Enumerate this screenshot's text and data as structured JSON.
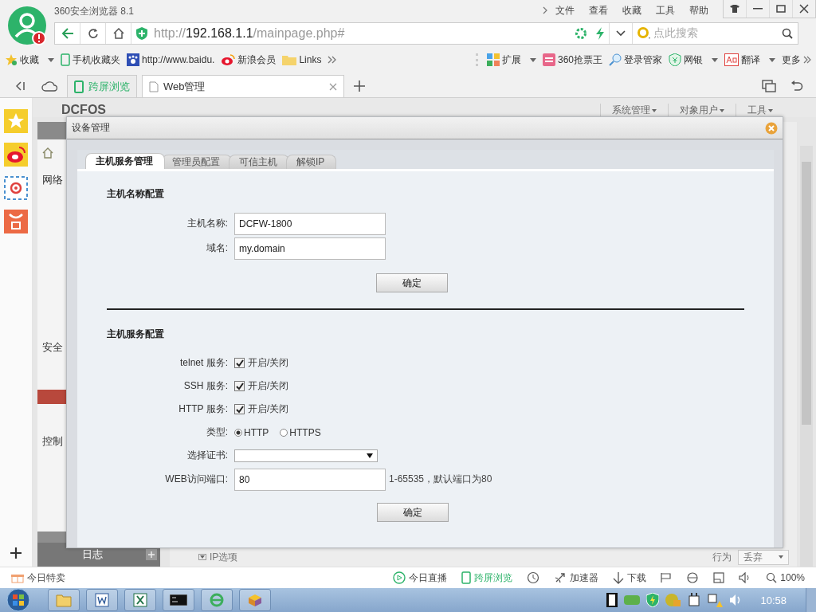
{
  "browser": {
    "title": "360安全浏览器 8.1",
    "menu": [
      "文件",
      "查看",
      "收藏",
      "工具",
      "帮助"
    ],
    "url": {
      "scheme": "http://",
      "host": "192.168.1.1",
      "path": "/mainpage.php#"
    },
    "search_placeholder": "点此搜索"
  },
  "bookmarks": [
    {
      "label": "收藏",
      "kind": "star"
    },
    {
      "label": "手机收藏夹",
      "kind": "phone"
    },
    {
      "label": "http://www.baidu.",
      "kind": "paw"
    },
    {
      "label": "新浪会员",
      "kind": "weibo"
    },
    {
      "label": "Links",
      "kind": "folder"
    }
  ],
  "extensions": [
    {
      "label": "扩展",
      "kind": "grid"
    },
    {
      "label": "360抢票王",
      "kind": "ticket"
    },
    {
      "label": "登录管家",
      "kind": "key"
    },
    {
      "label": "网银",
      "kind": "shield"
    },
    {
      "label": "翻译",
      "kind": "translate"
    },
    {
      "label": "更多",
      "kind": "more"
    }
  ],
  "tabs": [
    {
      "label": "跨屏浏览",
      "selected": false,
      "kind": "phone"
    },
    {
      "label": "Web管理",
      "selected": true,
      "kind": "page"
    }
  ],
  "page": {
    "logo": "DCFOS",
    "nav": [
      "系统管理",
      "对象用户",
      "工具"
    ],
    "groups": [
      "网络",
      "安全",
      "控制"
    ],
    "log": "日志",
    "ip_option": "IP选项",
    "action_label": "行为",
    "action_value": "丢弃"
  },
  "dialog": {
    "title": "设备管理",
    "tabs": [
      {
        "label": "主机服务管理",
        "selected": true
      },
      {
        "label": "管理员配置",
        "selected": false
      },
      {
        "label": "可信主机",
        "selected": false
      },
      {
        "label": "解锁IP",
        "selected": false
      }
    ],
    "host_section": {
      "title": "主机名称配置",
      "fields": [
        {
          "label": "主机名称:",
          "value": "DCFW-1800"
        },
        {
          "label": "域名:",
          "value": "my.domain"
        }
      ],
      "button": "确定"
    },
    "service_section": {
      "title": "主机服务配置",
      "services": [
        {
          "label": "telnet 服务:",
          "option": "开启/关闭",
          "checked": true
        },
        {
          "label": "SSH 服务:",
          "option": "开启/关闭",
          "checked": true
        },
        {
          "label": "HTTP 服务:",
          "option": "开启/关闭",
          "checked": true
        }
      ],
      "type": {
        "label": "类型:",
        "options": [
          {
            "label": "HTTP",
            "selected": true
          },
          {
            "label": "HTTPS",
            "selected": false
          }
        ]
      },
      "cert": {
        "label": "选择证书:"
      },
      "port": {
        "label": "WEB访问端口:",
        "value": "80",
        "hint": "1-65535，默认端口为80"
      },
      "button": "确定"
    }
  },
  "status_bar": {
    "left": "今日特卖",
    "items": [
      {
        "label": "今日直播",
        "kind": "play"
      },
      {
        "label": "跨屏浏览",
        "kind": "phone"
      },
      {
        "label": "加速器",
        "kind": "rocket"
      },
      {
        "label": "下载",
        "kind": "download"
      }
    ],
    "zoom": "100%"
  },
  "taskbar": {
    "clock": "10:58"
  }
}
